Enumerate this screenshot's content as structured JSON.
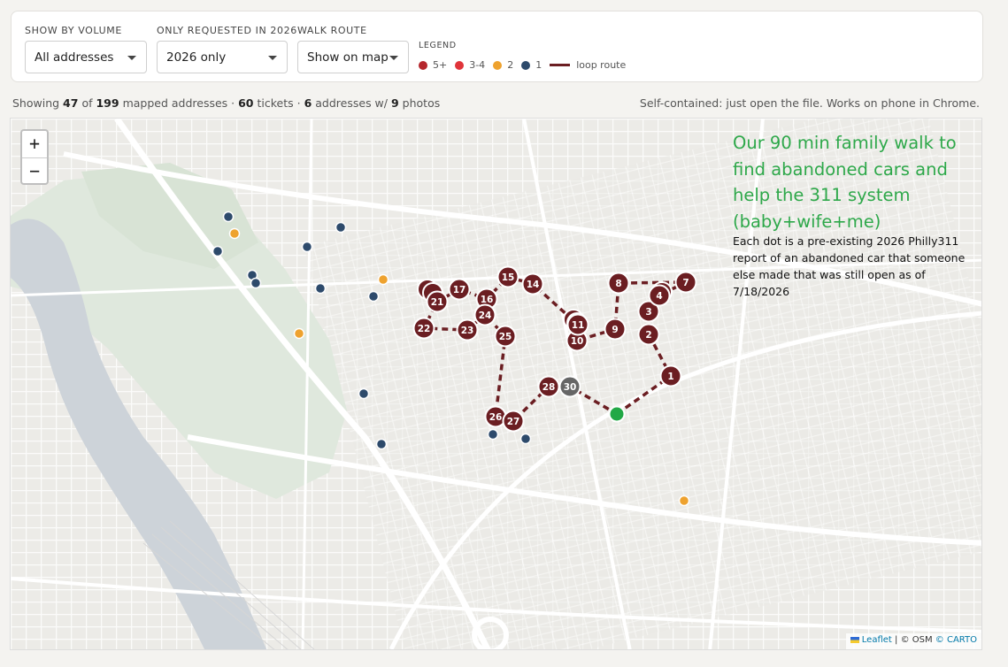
{
  "controls": {
    "volume": {
      "label": "SHOW BY VOLUME",
      "value": "All addresses"
    },
    "year": {
      "label": "ONLY REQUESTED IN 2026",
      "value": "2026 only"
    },
    "route": {
      "label": "WALK ROUTE",
      "value": "Show on map"
    }
  },
  "legend": {
    "title": "LEGEND",
    "items": [
      {
        "label": "5+",
        "color": "#b5272d"
      },
      {
        "label": "3-4",
        "color": "#e0343a"
      },
      {
        "label": "2",
        "color": "#eea22e"
      },
      {
        "label": "1",
        "color": "#2d4a6b"
      }
    ],
    "route_label": "loop route",
    "route_color": "#6b1e22"
  },
  "stats": {
    "prefix": "Showing",
    "shown": "47",
    "of": "of",
    "total": "199",
    "mapped_suffix": "mapped addresses ·",
    "tickets": "60",
    "tickets_suffix": "tickets ·",
    "addresses_with_photos": "6",
    "photos_mid": "addresses w/",
    "photos": "9",
    "photos_suffix": "photos"
  },
  "note": "Self-contained: just open the file. Works on phone in Chrome.",
  "map": {
    "zoom_in": "+",
    "zoom_out": "−",
    "walk_title": "Our 90 min family walk to find abandoned cars and help the 311 system (baby+wife+me)",
    "walk_desc": "Each dot is a pre-existing 2026 Philly311 report of an abandoned car that someone else made that was still open as of 7/18/2026",
    "attribution": {
      "leaflet": "Leaflet",
      "sep1": "|",
      "osm": "© OSM",
      "carto": "© CARTO"
    },
    "start_color": "#22a846",
    "stop_color": "#6b1e22",
    "stops": [
      {
        "n": "1"
      },
      {
        "n": "2"
      },
      {
        "n": "3"
      },
      {
        "n": "4"
      },
      {
        "n": "7"
      },
      {
        "n": "8"
      },
      {
        "n": "9"
      },
      {
        "n": "10"
      },
      {
        "n": "11"
      },
      {
        "n": "14"
      },
      {
        "n": "15"
      },
      {
        "n": "16"
      },
      {
        "n": "17"
      },
      {
        "n": "21"
      },
      {
        "n": "22"
      },
      {
        "n": "23"
      },
      {
        "n": "24"
      },
      {
        "n": "25"
      },
      {
        "n": "26"
      },
      {
        "n": "27"
      },
      {
        "n": "28"
      },
      {
        "n": "30"
      }
    ]
  }
}
